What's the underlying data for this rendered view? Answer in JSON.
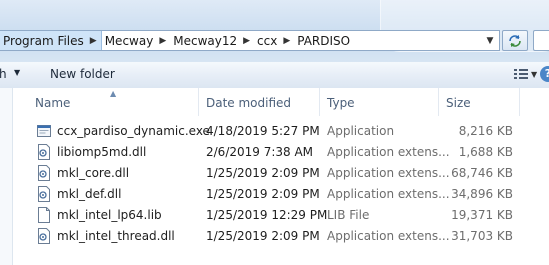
{
  "address_bar": {
    "crumbs": [
      "Program Files",
      "Mecway",
      "Mecway12",
      "ccx",
      "PARDISO"
    ]
  },
  "toolbar": {
    "partial_label": "h",
    "new_folder_label": "New folder",
    "help_label": "?"
  },
  "columns": {
    "name": "Name",
    "date_modified": "Date modified",
    "type": "Type",
    "size": "Size"
  },
  "files": [
    {
      "name": "ccx_pardiso_dynamic.exe",
      "date": "4/18/2019 5:27 PM",
      "type": "Application",
      "size": "8,216 KB",
      "icon": "application-exe-icon"
    },
    {
      "name": "libiomp5md.dll",
      "date": "2/6/2019 7:38 AM",
      "type": "Application extens...",
      "size": "1,688 KB",
      "icon": "dll-file-icon"
    },
    {
      "name": "mkl_core.dll",
      "date": "1/25/2019 2:09 PM",
      "type": "Application extens...",
      "size": "68,746 KB",
      "icon": "dll-file-icon"
    },
    {
      "name": "mkl_def.dll",
      "date": "1/25/2019 2:09 PM",
      "type": "Application extens...",
      "size": "34,896 KB",
      "icon": "dll-file-icon"
    },
    {
      "name": "mkl_intel_lp64.lib",
      "date": "1/25/2019 12:29 PM",
      "type": "LIB File",
      "size": "19,371 KB",
      "icon": "generic-file-icon"
    },
    {
      "name": "mkl_intel_thread.dll",
      "date": "1/25/2019 2:09 PM",
      "type": "Application extens...",
      "size": "31,703 KB",
      "icon": "dll-file-icon"
    }
  ],
  "colors": {
    "accent": "#cfe4f8",
    "header_text": "#4c607a",
    "muted_text": "#6d6d6d"
  }
}
